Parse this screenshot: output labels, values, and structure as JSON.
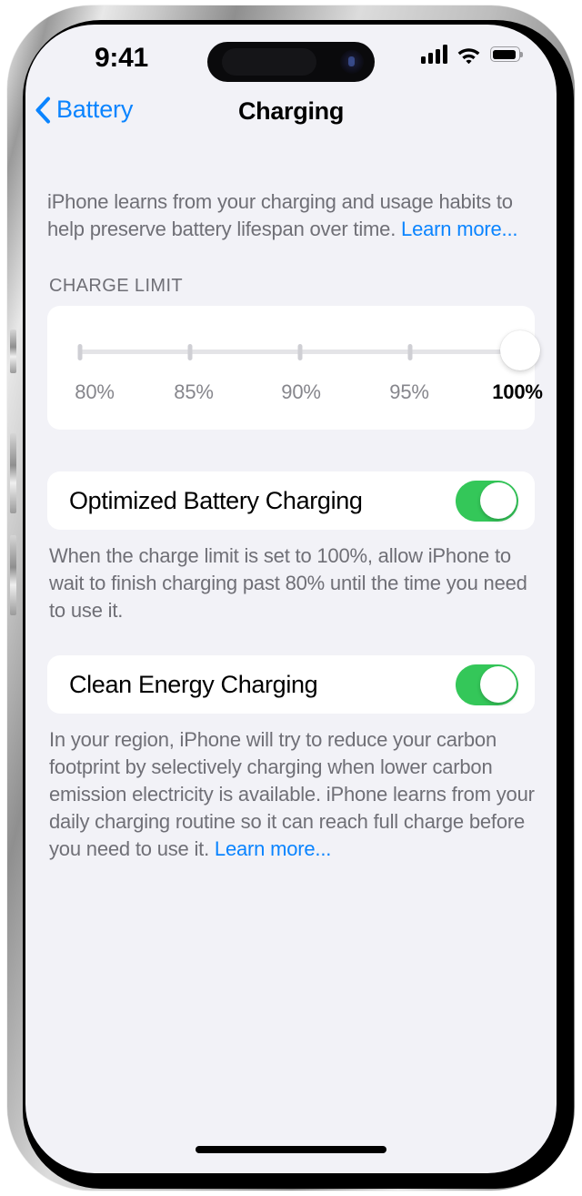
{
  "status_bar": {
    "time": "9:41",
    "cellular_icon": "cellular-signal-icon",
    "wifi_icon": "wifi-icon",
    "battery_icon": "battery-full-icon"
  },
  "nav": {
    "back_icon": "chevron-left-icon",
    "back_label": "Battery",
    "title": "Charging"
  },
  "intro": {
    "text": "iPhone learns from your charging and usage habits to help preserve battery lifespan over time. ",
    "link_label": "Learn more..."
  },
  "charge_limit": {
    "header": "CHARGE LIMIT",
    "options": [
      "80%",
      "85%",
      "90%",
      "95%",
      "100%"
    ],
    "selected": "100%",
    "selected_index": 4
  },
  "optimized": {
    "label": "Optimized Battery Charging",
    "toggle_state": "on",
    "footnote": "When the charge limit is set to 100%, allow iPhone to wait to finish charging past 80% until the time you need to use it."
  },
  "clean_energy": {
    "label": "Clean Energy Charging",
    "toggle_state": "on",
    "footnote": "In your region, iPhone will try to reduce your carbon footprint by selectively charging when lower carbon emission electricity is available. iPhone learns from your daily charging routine so it can reach full charge before you need to use it. ",
    "link_label": "Learn more..."
  },
  "colors": {
    "accent_blue": "#0A84FF",
    "toggle_green": "#34C759",
    "background": "#F2F2F7",
    "card": "#FFFFFF",
    "secondary_text": "#6F6F76"
  },
  "home_indicator": "home-indicator"
}
